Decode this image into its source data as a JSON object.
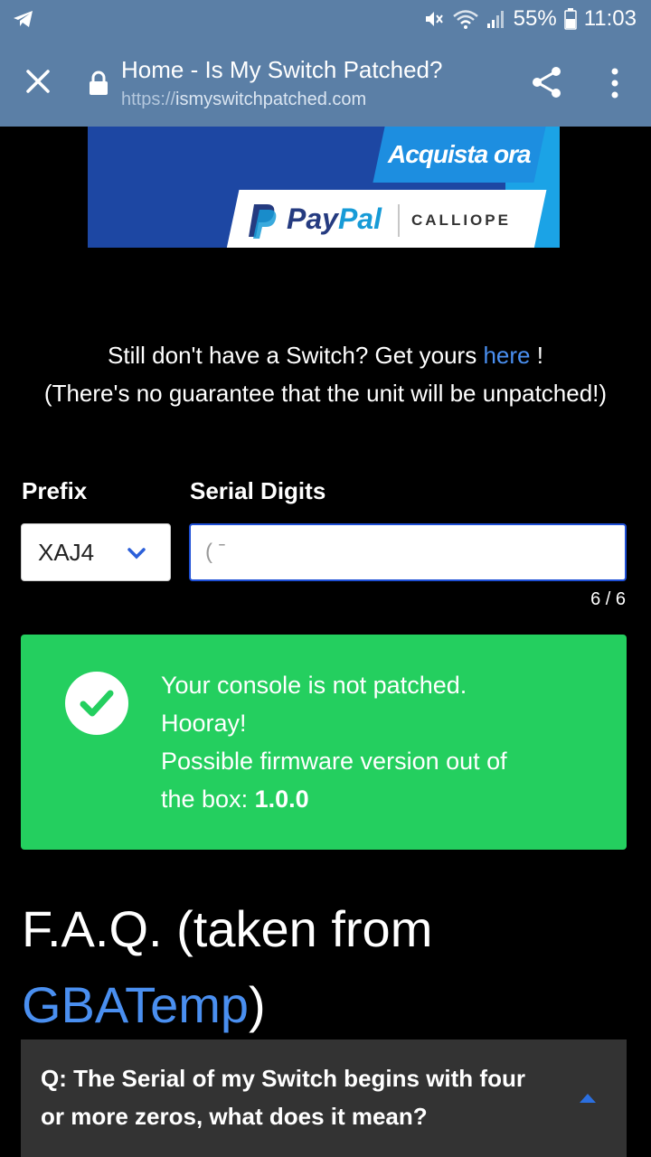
{
  "status_bar": {
    "battery_percent": "55%",
    "time": "11:03",
    "icons": [
      "telegram-icon",
      "mute-icon",
      "wifi-icon",
      "signal-icon",
      "battery-icon"
    ]
  },
  "browser": {
    "title": "Home - Is My Switch Patched?",
    "url_scheme": "https://",
    "url_host": "ismyswitchpatched.com"
  },
  "ad": {
    "cta": "Acquista ora",
    "paypal_pay": "Pay",
    "paypal_pal": "Pal",
    "partner": "CALLIOPE",
    "colors": {
      "dark_blue": "#1d47a3",
      "light_blue": "#1ba3e6"
    }
  },
  "intro": {
    "line1_prefix": "Still don't have a Switch? Get yours ",
    "line1_link": "here",
    "line1_suffix": " !",
    "line2": "(There's no guarantee that the unit will be unpatched!)"
  },
  "form": {
    "prefix_label": "Prefix",
    "serial_label": "Serial Digits",
    "prefix_value": "XAJ4",
    "serial_value": "( ˉ",
    "counter": "6 / 6"
  },
  "result": {
    "line1": "Your console is not patched.",
    "line2": "Hooray!",
    "line3": "Possible firmware version out of",
    "line4_prefix": "the box: ",
    "firmware": "1.0.0",
    "color": "#24cf5f"
  },
  "faq": {
    "title_prefix": "F.A.Q. (taken from ",
    "title_link": "GBATemp",
    "title_suffix": ")",
    "question": "Q: The Serial of my Switch begins with four or more zeros, what does it mean?"
  }
}
